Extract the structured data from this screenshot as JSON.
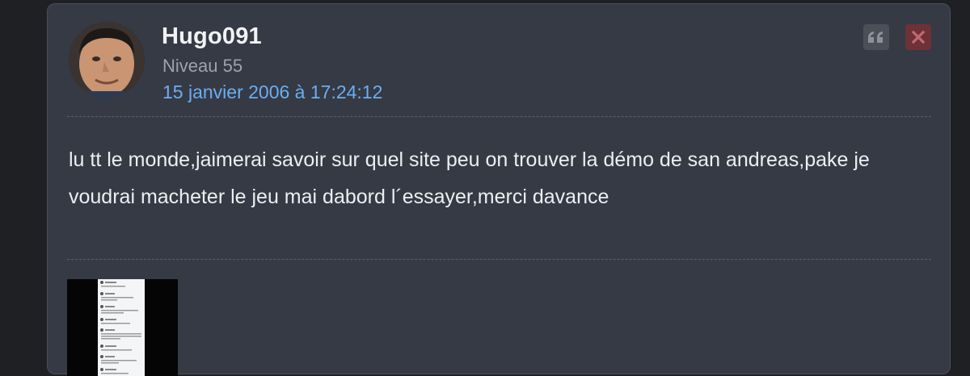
{
  "post": {
    "username": "Hugo091",
    "level": "Niveau 55",
    "date": "15 janvier 2006 à 17:24:12",
    "message": "lu tt le monde,jaimerai savoir sur quel site peu on trouver la démo de san andreas,pake je voudrai macheter le jeu mai dabord l´essayer,merci davance",
    "actions": {
      "quote_icon": "quote-icon",
      "delete_icon": "close-icon"
    },
    "colors": {
      "background": "#363a44",
      "date_link": "#6aaef3",
      "delete_button": "#6e3136",
      "quote_button": "#4b4f58"
    }
  }
}
